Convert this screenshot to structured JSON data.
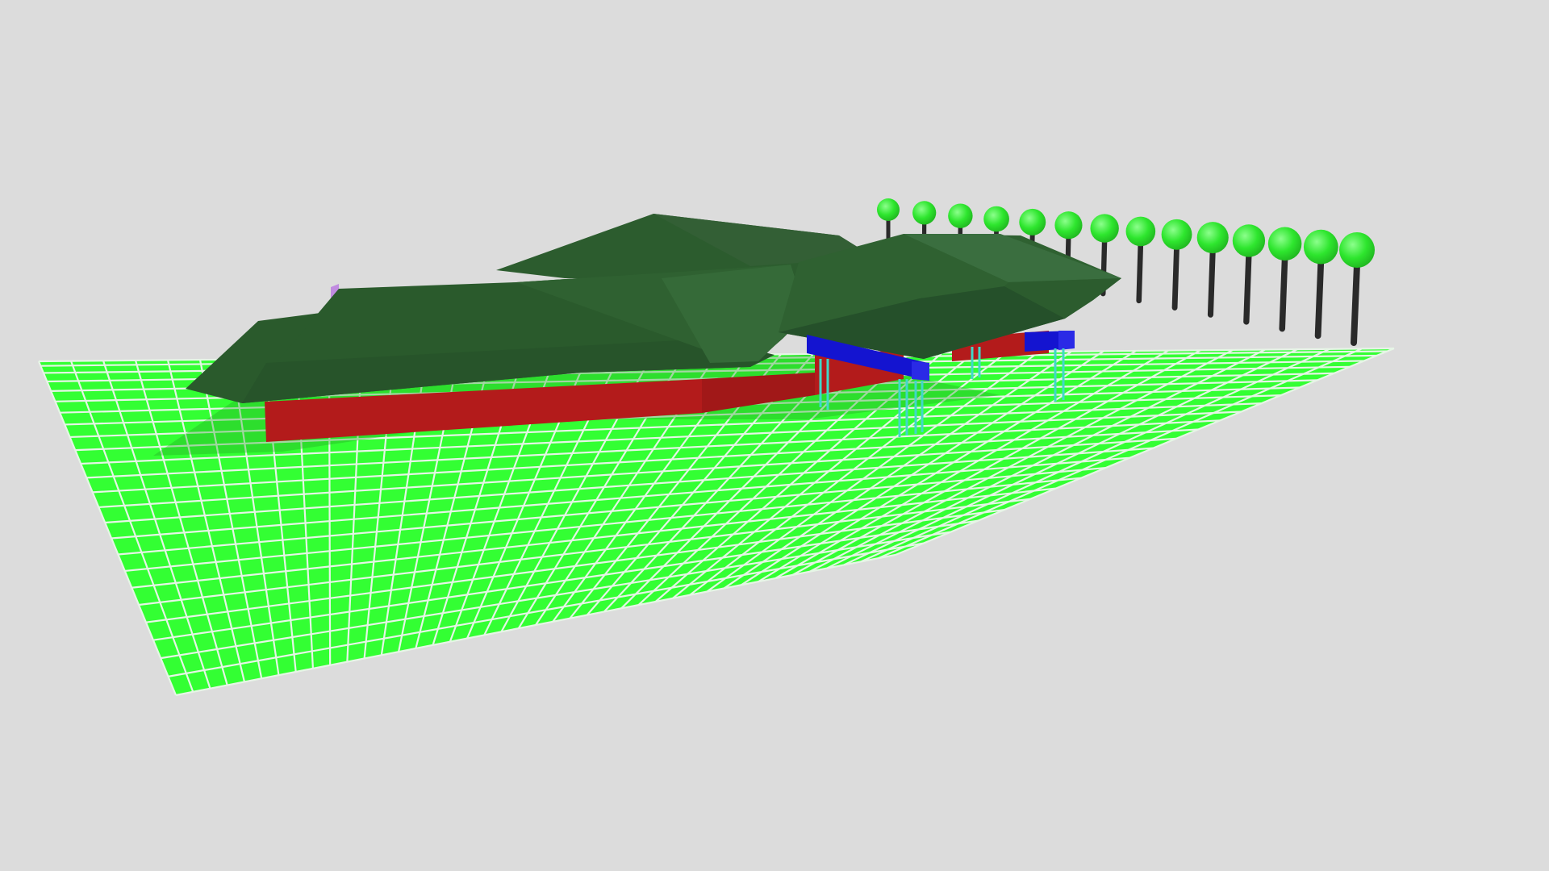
{
  "viewer": {
    "background": "#dcdcdc"
  },
  "scene": {
    "ground": {
      "fill": "#33ff33",
      "grid_line_color": "#e6f5e6",
      "columns": 42,
      "rows": 24
    },
    "building": {
      "wall_color": "#b31b1b",
      "roof_colors": [
        "#2a5a2c",
        "#2f6131",
        "#25502a",
        "#35683a",
        "#3a6e3f"
      ],
      "trim_color": "#c08be0",
      "beam_color": "#1414d0",
      "column_color": "#40d8c8"
    },
    "trees": {
      "count": 14,
      "trunk_color": "#2a2a2a",
      "canopy_color": "#2ee62e",
      "canopy_highlight": "#8cff8c"
    }
  }
}
